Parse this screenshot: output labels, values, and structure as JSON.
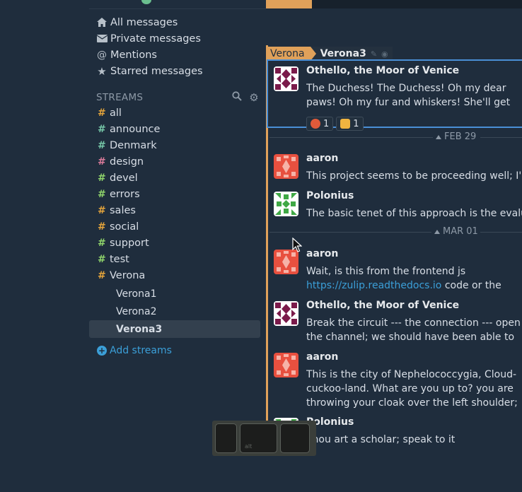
{
  "global_filters": [
    {
      "label": "All messages",
      "icon": "home-icon"
    },
    {
      "label": "Private messages",
      "icon": "envelope-icon"
    },
    {
      "label": "Mentions",
      "icon": "at-icon"
    },
    {
      "label": "Starred messages",
      "icon": "star-icon"
    }
  ],
  "streams_header": "STREAMS",
  "streams": [
    {
      "name": "all",
      "color": "#e2a33b"
    },
    {
      "name": "announce",
      "color": "#76c7a8"
    },
    {
      "name": "Denmark",
      "color": "#76c7a8"
    },
    {
      "name": "design",
      "color": "#d97a9a"
    },
    {
      "name": "devel",
      "color": "#8fd46b"
    },
    {
      "name": "errors",
      "color": "#8fd46b"
    },
    {
      "name": "sales",
      "color": "#e2a33b"
    },
    {
      "name": "social",
      "color": "#e2a33b"
    },
    {
      "name": "support",
      "color": "#8fd46b"
    },
    {
      "name": "test",
      "color": "#8fd46b"
    },
    {
      "name": "Verona",
      "color": "#e2a33b"
    }
  ],
  "topics": [
    "Verona1",
    "Verona2",
    "Verona3"
  ],
  "add_streams": "Add streams",
  "recipient": {
    "stream": "Verona",
    "topic": "Verona3"
  },
  "messages": [
    {
      "sender": "Othello, the Moor of Venice",
      "body": "The Duchess! The Duchess! Oh my dear paws! Oh my fur and whiskers! She'll get me executed, as sure as ferrets are ferrets! Where CAN I have dropped them, I wonder?",
      "reactions": [
        {
          "count": "1",
          "color": "#e05a3a"
        },
        {
          "count": "1",
          "color": "#f0b440"
        }
      ]
    },
    {
      "sender": "aaron",
      "body": "This project seems to be proceeding well; I'm looking forward to seeing how it turns out."
    },
    {
      "sender": "Polonius",
      "body": "The basic tenet of this approach is the evaluation of the data."
    },
    {
      "sender": "aaron",
      "body_pre": "Wait, is this from the frontend js ",
      "link": "https://zulip.readthedocs.io",
      "body_post": " code or the backend python code"
    },
    {
      "sender": "Othello, the Moor of Venice",
      "body": "Break the circuit --- the connection --- open the channel; we should have been able to catch!"
    },
    {
      "sender": "aaron",
      "body": "This is the city of Nephelococcygia, Cloud-cuckoo-land. What are you up to? you are throwing your cloak over the left shoulder; why does it draggle in this fashion? Have you ulcers?"
    },
    {
      "sender": "Polonius",
      "body": "Thou art a scholar; speak to it"
    }
  ],
  "dates": [
    "FEB 29",
    "MAR 01"
  ],
  "keys": {
    "alt_label": "alt"
  }
}
